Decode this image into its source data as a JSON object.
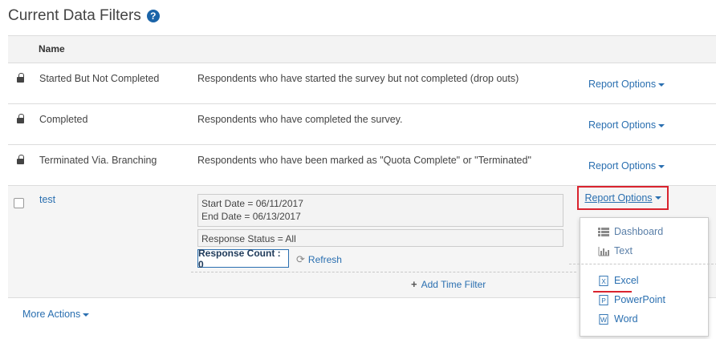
{
  "header": {
    "title": "Current Data Filters",
    "help_icon": "question-circle-icon"
  },
  "table": {
    "column_name": "Name",
    "rows": [
      {
        "name": "Started But Not Completed",
        "description": "Respondents who have started the survey but not completed (drop outs)",
        "action": "Report Options"
      },
      {
        "name": "Completed",
        "description": "Respondents who have completed the survey.",
        "action": "Report Options"
      },
      {
        "name": "Terminated Via. Branching",
        "description": "Respondents who have been marked as \"Quota Complete\" or \"Terminated\"",
        "action": "Report Options"
      }
    ],
    "custom_filter": {
      "name": "test",
      "start_date": "Start Date = 06/11/2017",
      "end_date": "End Date = 06/13/2017",
      "response_status": "Response Status = All",
      "response_count": "Response Count : 0",
      "refresh": "Refresh",
      "add_time_filter": "Add Time Filter",
      "action": "Report Options"
    }
  },
  "more_actions": "More Actions",
  "dropdown": {
    "items": [
      {
        "label": "Dashboard",
        "icon": "table-icon"
      },
      {
        "label": "Text",
        "icon": "bar-chart-icon"
      },
      {
        "label": "Excel",
        "icon": "excel-file-icon"
      },
      {
        "label": "PowerPoint",
        "icon": "powerpoint-file-icon"
      },
      {
        "label": "Word",
        "icon": "word-file-icon"
      }
    ]
  },
  "colors": {
    "link": "#2a6fb0",
    "highlight": "#d9232e",
    "help": "#1b64a8"
  }
}
